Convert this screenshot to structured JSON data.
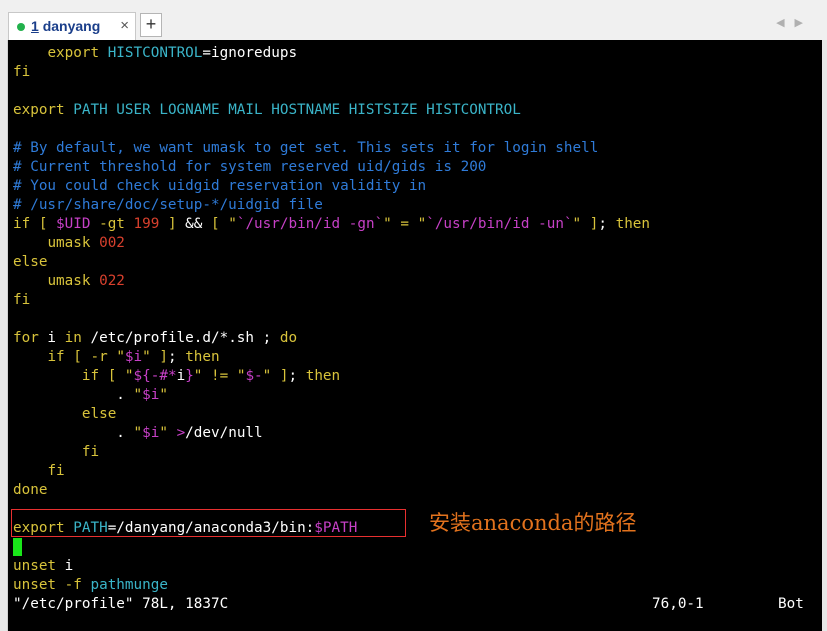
{
  "tab": {
    "number": "1",
    "title": "danyang",
    "close": "×"
  },
  "toolbar": {
    "new_tab": "+",
    "prev": "◀",
    "next": "▶"
  },
  "annotation": "安装anaconda的路径",
  "status": {
    "file": "\"/etc/profile\" 78L, 1837C",
    "position": "76,0-1",
    "scroll": "Bot"
  },
  "colors": {
    "background": "#000000",
    "comment": "#2f7bd8",
    "keyword": "#d8c33b",
    "identifier": "#3ab4c8",
    "string": "#c640c6",
    "number": "#d8402d",
    "cursor": "#19e619",
    "highlight_border": "#e83030",
    "annotation": "#e2721d"
  },
  "lines": [
    [
      [
        "w",
        "    "
      ],
      [
        "y",
        "export"
      ],
      [
        "w",
        " "
      ],
      [
        "cy",
        "HISTCONTROL"
      ],
      [
        "w",
        "="
      ],
      [
        "w",
        "ignoredups"
      ]
    ],
    [
      [
        "y",
        "fi"
      ]
    ],
    [],
    [
      [
        "y",
        "export"
      ],
      [
        "w",
        " "
      ],
      [
        "cy",
        "PATH USER LOGNAME MAIL HOSTNAME HISTSIZE HISTCONTROL"
      ]
    ],
    [],
    [
      [
        "c",
        "# By default, we want umask to get set. This sets it for login shell"
      ]
    ],
    [
      [
        "c",
        "# Current threshold for system reserved uid/gids is 200"
      ]
    ],
    [
      [
        "c",
        "# You could check uidgid reservation validity in"
      ]
    ],
    [
      [
        "c",
        "# /usr/share/doc/setup-*/uidgid file"
      ]
    ],
    [
      [
        "y",
        "if"
      ],
      [
        "w",
        " "
      ],
      [
        "y",
        "["
      ],
      [
        "w",
        " "
      ],
      [
        "m",
        "$UID"
      ],
      [
        "w",
        " "
      ],
      [
        "y",
        "-gt"
      ],
      [
        "w",
        " "
      ],
      [
        "r",
        "199"
      ],
      [
        "w",
        " "
      ],
      [
        "y",
        "]"
      ],
      [
        "w",
        " && "
      ],
      [
        "y",
        "["
      ],
      [
        "w",
        " "
      ],
      [
        "y",
        "\""
      ],
      [
        "m",
        "`/usr/bin/id -gn`"
      ],
      [
        "y",
        "\""
      ],
      [
        "w",
        " "
      ],
      [
        "y",
        "="
      ],
      [
        "w",
        " "
      ],
      [
        "y",
        "\""
      ],
      [
        "m",
        "`/usr/bin/id -un`"
      ],
      [
        "y",
        "\""
      ],
      [
        "w",
        " "
      ],
      [
        "y",
        "]"
      ],
      [
        "w",
        "; "
      ],
      [
        "y",
        "then"
      ]
    ],
    [
      [
        "w",
        "    "
      ],
      [
        "y",
        "umask"
      ],
      [
        "w",
        " "
      ],
      [
        "r",
        "002"
      ]
    ],
    [
      [
        "y",
        "else"
      ]
    ],
    [
      [
        "w",
        "    "
      ],
      [
        "y",
        "umask"
      ],
      [
        "w",
        " "
      ],
      [
        "r",
        "022"
      ]
    ],
    [
      [
        "y",
        "fi"
      ]
    ],
    [],
    [
      [
        "y",
        "for"
      ],
      [
        "w",
        " i "
      ],
      [
        "y",
        "in"
      ],
      [
        "w",
        " /etc/profile.d/*.sh ; "
      ],
      [
        "y",
        "do"
      ]
    ],
    [
      [
        "w",
        "    "
      ],
      [
        "y",
        "if"
      ],
      [
        "w",
        " "
      ],
      [
        "y",
        "["
      ],
      [
        "w",
        " "
      ],
      [
        "y",
        "-r"
      ],
      [
        "w",
        " "
      ],
      [
        "y",
        "\""
      ],
      [
        "m",
        "$i"
      ],
      [
        "y",
        "\""
      ],
      [
        "w",
        " "
      ],
      [
        "y",
        "]"
      ],
      [
        "w",
        "; "
      ],
      [
        "y",
        "then"
      ]
    ],
    [
      [
        "w",
        "        "
      ],
      [
        "y",
        "if"
      ],
      [
        "w",
        " "
      ],
      [
        "y",
        "["
      ],
      [
        "w",
        " "
      ],
      [
        "y",
        "\""
      ],
      [
        "m",
        "${-#*"
      ],
      [
        "w",
        "i"
      ],
      [
        "m",
        "}"
      ],
      [
        "y",
        "\""
      ],
      [
        "w",
        " "
      ],
      [
        "y",
        "!="
      ],
      [
        "w",
        " "
      ],
      [
        "y",
        "\""
      ],
      [
        "m",
        "$-"
      ],
      [
        "y",
        "\""
      ],
      [
        "w",
        " "
      ],
      [
        "y",
        "]"
      ],
      [
        "w",
        "; "
      ],
      [
        "y",
        "then"
      ]
    ],
    [
      [
        "w",
        "            . "
      ],
      [
        "y",
        "\""
      ],
      [
        "m",
        "$i"
      ],
      [
        "y",
        "\""
      ]
    ],
    [
      [
        "w",
        "        "
      ],
      [
        "y",
        "else"
      ]
    ],
    [
      [
        "w",
        "            . "
      ],
      [
        "y",
        "\""
      ],
      [
        "m",
        "$i"
      ],
      [
        "y",
        "\""
      ],
      [
        "w",
        " "
      ],
      [
        "m",
        ">"
      ],
      [
        "w",
        "/dev/null"
      ]
    ],
    [
      [
        "w",
        "        "
      ],
      [
        "y",
        "fi"
      ]
    ],
    [
      [
        "w",
        "    "
      ],
      [
        "y",
        "fi"
      ]
    ],
    [
      [
        "y",
        "done"
      ]
    ],
    [],
    [
      [
        "y",
        "export"
      ],
      [
        "w",
        " "
      ],
      [
        "cy",
        "PATH"
      ],
      [
        "w",
        "=/danyang/anaconda3/bin:"
      ],
      [
        "m",
        "$PATH"
      ]
    ],
    [],
    [
      [
        "y",
        "unset"
      ],
      [
        "w",
        " i"
      ]
    ],
    [
      [
        "y",
        "unset"
      ],
      [
        "w",
        " "
      ],
      [
        "y",
        "-f"
      ],
      [
        "w",
        " "
      ],
      [
        "cy",
        "pathmunge"
      ]
    ]
  ]
}
